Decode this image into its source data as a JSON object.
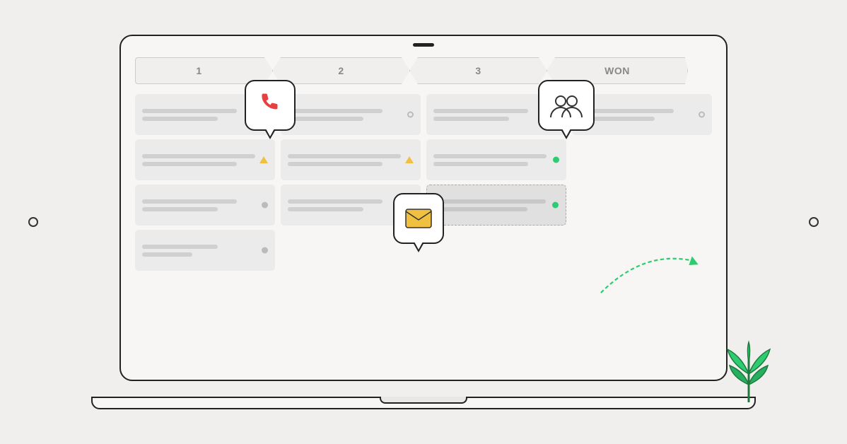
{
  "stages": [
    {
      "id": "stage-1",
      "label": "1"
    },
    {
      "id": "stage-2",
      "label": "2"
    },
    {
      "id": "stage-3",
      "label": "3"
    },
    {
      "id": "stage-won",
      "label": "WON"
    }
  ],
  "columns": [
    {
      "id": "col-1",
      "cards": [
        {
          "id": "card-1-1",
          "status": "dot-red",
          "highlighted": false
        },
        {
          "id": "card-1-2",
          "status": "triangle",
          "highlighted": false
        },
        {
          "id": "card-1-3",
          "status": "dot-gray",
          "highlighted": false
        },
        {
          "id": "card-1-4",
          "status": "dot-gray",
          "highlighted": false
        }
      ]
    },
    {
      "id": "col-2",
      "cards": [
        {
          "id": "card-2-1",
          "status": "dot-outline",
          "highlighted": false
        },
        {
          "id": "card-2-2",
          "status": "triangle",
          "highlighted": false
        },
        {
          "id": "card-2-3",
          "status": "dot-gray",
          "highlighted": false
        }
      ]
    },
    {
      "id": "col-3",
      "cards": [
        {
          "id": "card-3-1",
          "status": "dot-outline",
          "highlighted": false
        },
        {
          "id": "card-3-2",
          "status": "dot-green",
          "highlighted": false
        },
        {
          "id": "card-3-3",
          "status": "dot-green",
          "highlighted": true
        }
      ]
    },
    {
      "id": "col-won",
      "cards": [
        {
          "id": "card-w-1",
          "status": "dot-outline",
          "highlighted": false
        }
      ]
    }
  ],
  "icons": {
    "phone": "📞",
    "won_label": "WON"
  },
  "colors": {
    "background": "#f0efed",
    "card": "#ebebeb",
    "border": "#222222",
    "accent_green": "#2ecc71",
    "accent_red": "#e84040",
    "accent_yellow": "#f0c040",
    "stage_bg": "#f0efed"
  }
}
